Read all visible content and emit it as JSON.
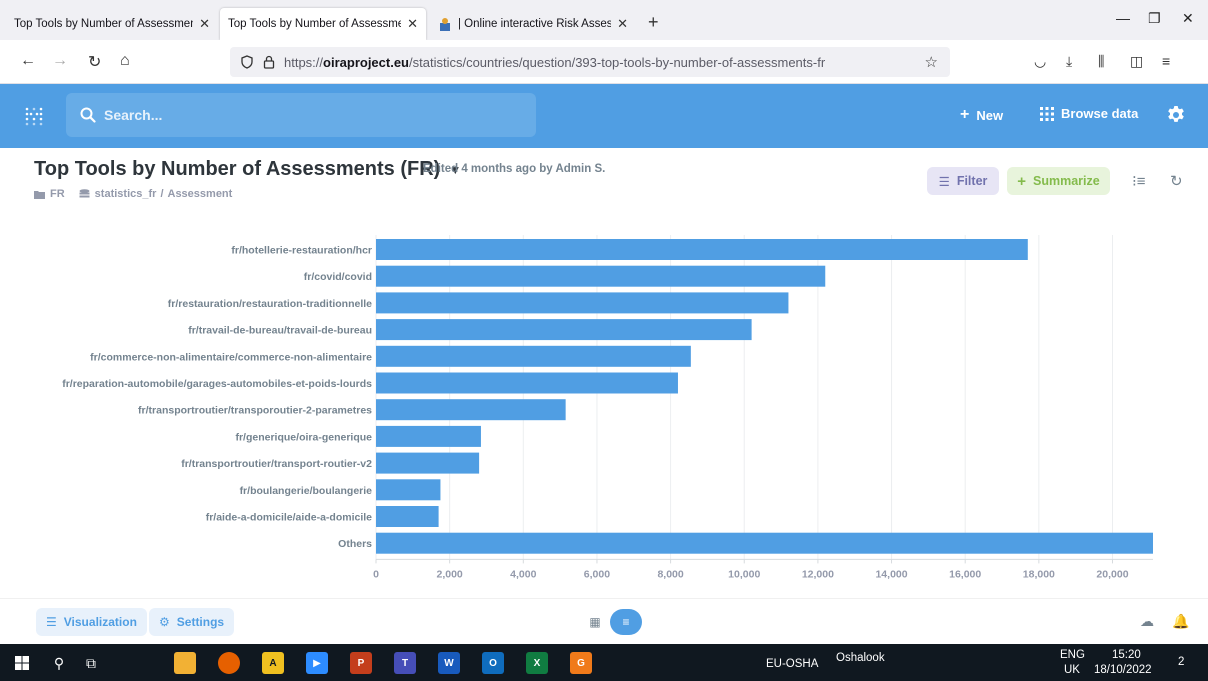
{
  "browser": {
    "tabs": [
      {
        "title": "Top Tools by Number of Assessmen",
        "active": false
      },
      {
        "title": "Top Tools by Number of Assessmen",
        "active": true
      },
      {
        "title": "| Online interactive Risk Assessm",
        "active": false
      }
    ],
    "new_tab": "+",
    "url_prefix": "https://",
    "url_domain": "oiraproject.eu",
    "url_path": "/statistics/countries/question/393-top-tools-by-number-of-assessments-fr"
  },
  "app": {
    "search_placeholder": "Search...",
    "new_label": "New",
    "browse_label": "Browse data",
    "accent": "#509ee3"
  },
  "question": {
    "title": "Top Tools by Number of Assessments (FR)",
    "edited": "Edited 4 months ago by Admin S.",
    "collection": "FR",
    "database": "statistics_fr",
    "table": "Assessment",
    "filter_label": "Filter",
    "summarize_label": "Summarize"
  },
  "chart_data": {
    "type": "bar",
    "orientation": "horizontal",
    "categories": [
      "fr/hotellerie-restauration/hcr",
      "fr/covid/covid",
      "fr/restauration/restauration-traditionnelle",
      "fr/travail-de-bureau/travail-de-bureau",
      "fr/commerce-non-alimentaire/commerce-non-alimentaire",
      "fr/reparation-automobile/garages-automobiles-et-poids-lourds",
      "fr/transportroutier/transporoutier-2-parametres",
      "fr/generique/oira-generique",
      "fr/transportroutier/transport-routier-v2",
      "fr/boulangerie/boulangerie",
      "fr/aide-a-domicile/aide-a-domicile",
      "Others"
    ],
    "values": [
      17700,
      12200,
      11200,
      10200,
      8550,
      8200,
      5150,
      2850,
      2800,
      1750,
      1700,
      21100
    ],
    "xlim": [
      0,
      21100
    ],
    "xticks": [
      0,
      2000,
      4000,
      6000,
      8000,
      10000,
      12000,
      14000,
      16000,
      18000,
      20000
    ],
    "xtick_labels": [
      "0",
      "2,000",
      "4,000",
      "6,000",
      "8,000",
      "10,000",
      "12,000",
      "14,000",
      "16,000",
      "18,000",
      "20,000"
    ],
    "bar_color": "#509ee3",
    "grid": true
  },
  "footer": {
    "visualization_label": "Visualization",
    "settings_label": "Settings"
  },
  "taskbar": {
    "network": "EU-OSHA",
    "oshalook": "Oshalook",
    "lang1": "ENG",
    "lang2": "UK",
    "time": "15:20",
    "date": "18/10/2022",
    "notif_count": "2"
  }
}
